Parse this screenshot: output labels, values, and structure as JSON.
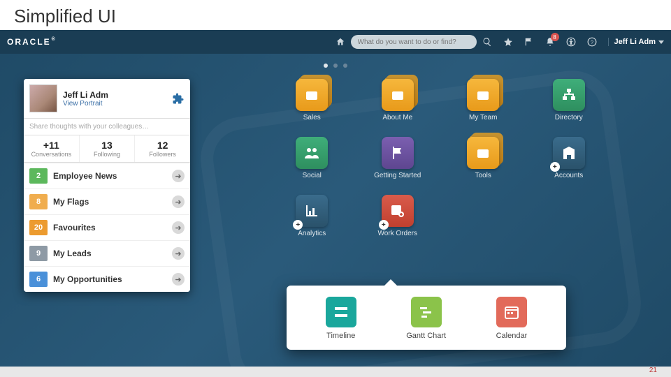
{
  "slide": {
    "title": "Simplified UI",
    "pageNumber": "21"
  },
  "topbar": {
    "logo": "ORACLE",
    "search_placeholder": "What do you want to do or find?",
    "notif_count": "8",
    "username": "Jeff Li Adm"
  },
  "profile": {
    "name": "Jeff Li Adm",
    "link": "View Portrait",
    "share_placeholder": "Share thoughts with your colleagues…"
  },
  "stats": [
    {
      "value": "+11",
      "label": "Conversations"
    },
    {
      "value": "13",
      "label": "Following"
    },
    {
      "value": "12",
      "label": "Followers"
    }
  ],
  "rows": [
    {
      "count": "2",
      "label": "Employee News",
      "color": "c-green"
    },
    {
      "count": "8",
      "label": "My Flags",
      "color": "c-orange"
    },
    {
      "count": "20",
      "label": "Favourites",
      "color": "c-orange2"
    },
    {
      "count": "9",
      "label": "My Leads",
      "color": "c-gray"
    },
    {
      "count": "6",
      "label": "My Opportunities",
      "color": "c-blue"
    }
  ],
  "tiles": [
    {
      "label": "Sales",
      "bg": "bg-yellow",
      "stack": true,
      "icon": "folders"
    },
    {
      "label": "About Me",
      "bg": "bg-yellow",
      "stack": true,
      "icon": "folders"
    },
    {
      "label": "My Team",
      "bg": "bg-yellow",
      "stack": true,
      "icon": "folders"
    },
    {
      "label": "Directory",
      "bg": "bg-green",
      "stack": false,
      "icon": "org"
    },
    {
      "label": "Social",
      "bg": "bg-green",
      "stack": false,
      "icon": "people"
    },
    {
      "label": "Getting Started",
      "bg": "bg-purple",
      "stack": false,
      "icon": "flag"
    },
    {
      "label": "Tools",
      "bg": "bg-yellow",
      "stack": true,
      "icon": "folders"
    },
    {
      "label": "Accounts",
      "bg": "bg-navy",
      "stack": false,
      "icon": "building",
      "plus": true
    },
    {
      "label": "Analytics",
      "bg": "bg-navy",
      "stack": false,
      "icon": "chart",
      "plus": true
    },
    {
      "label": "Work Orders",
      "bg": "bg-red",
      "stack": false,
      "icon": "wrench",
      "plus": true
    }
  ],
  "popup": [
    {
      "label": "Timeline",
      "bg": "bg-teal",
      "icon": "timeline"
    },
    {
      "label": "Gantt Chart",
      "bg": "bg-ltgreen",
      "icon": "gantt"
    },
    {
      "label": "Calendar",
      "bg": "bg-ored",
      "icon": "calendar"
    }
  ]
}
